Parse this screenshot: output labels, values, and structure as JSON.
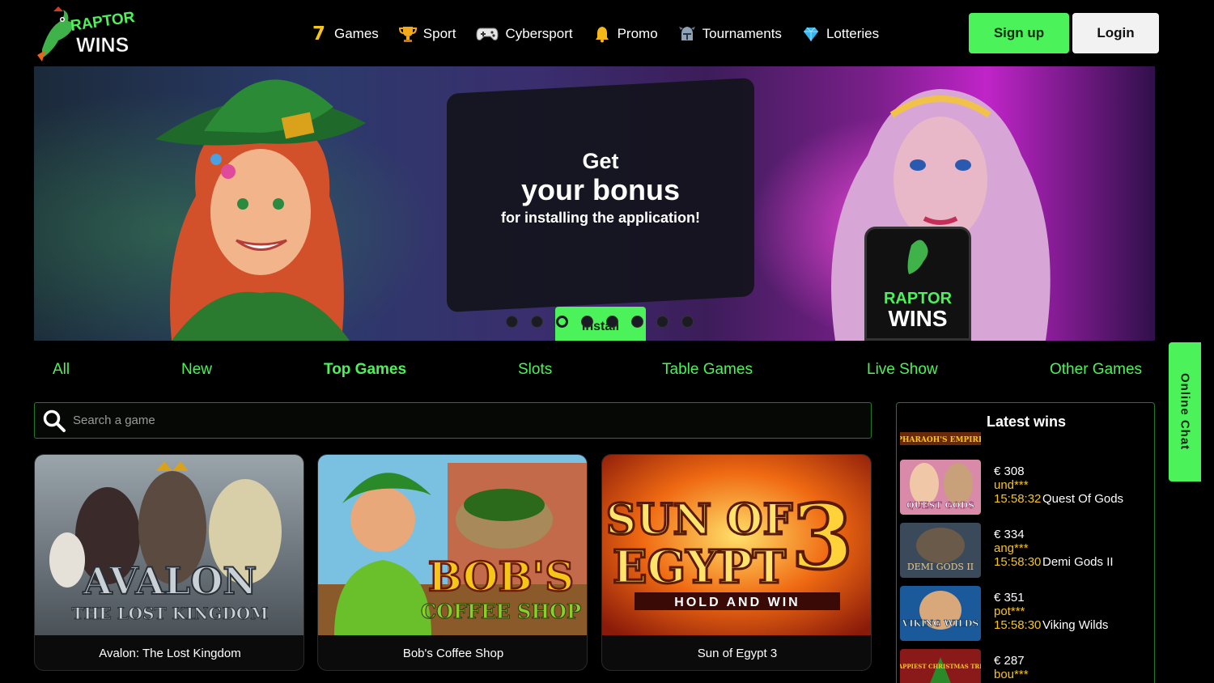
{
  "brand": {
    "logo_line1": "RAPTOR",
    "logo_line2": "WINS",
    "accent": "#4cf25a",
    "gold": "#f5c518"
  },
  "nav": {
    "items": [
      {
        "label": "Games",
        "icon": "seven-icon"
      },
      {
        "label": "Sport",
        "icon": "trophy-icon"
      },
      {
        "label": "Cybersport",
        "icon": "gamepad-icon"
      },
      {
        "label": "Promo",
        "icon": "bell-icon"
      },
      {
        "label": "Tournaments",
        "icon": "knight-helmet-icon"
      },
      {
        "label": "Lotteries",
        "icon": "diamond-icon"
      }
    ],
    "signup_label": "Sign up",
    "login_label": "Login"
  },
  "banner": {
    "line1": "Get",
    "line2": "your bonus",
    "line3": "for installing the application!",
    "install_label": "Install",
    "dots_count": 8,
    "active_dot": 3,
    "phone_logo_line1": "RAPTOR",
    "phone_logo_line2": "WINS"
  },
  "categories": [
    {
      "label": "All",
      "active": false
    },
    {
      "label": "New",
      "active": false
    },
    {
      "label": "Top Games",
      "active": true
    },
    {
      "label": "Slots",
      "active": false
    },
    {
      "label": "Table Games",
      "active": false
    },
    {
      "label": "Live Show",
      "active": false
    },
    {
      "label": "Other Games",
      "active": false
    }
  ],
  "search": {
    "placeholder": "Search a game"
  },
  "games": [
    {
      "title": "Avalon: The Lost Kingdom",
      "art_line1": "AVALON",
      "art_line2": "THE LOST KINGDOM"
    },
    {
      "title": "Bob's Coffee Shop",
      "art_line1": "BOB'S",
      "art_line2": "COFFEE SHOP"
    },
    {
      "title": "Sun of Egypt 3",
      "art_line1": "SUN OF",
      "art_line2": "EGYPT",
      "art_line3": "3",
      "art_line4": "HOLD AND WIN"
    }
  ],
  "latest_wins": {
    "title": "Latest wins",
    "partial_top_art": "PHARAOH'S EMPIRE",
    "items": [
      {
        "amount": "€ 308",
        "user": "und***",
        "time": "15:58:32",
        "game": "Quest Of Gods",
        "art": "QUEST GODS"
      },
      {
        "amount": "€ 334",
        "user": "ang***",
        "time": "15:58:30",
        "game": "Demi Gods II",
        "art": "DEMI GODS II"
      },
      {
        "amount": "€ 351",
        "user": "pot***",
        "time": "15:58:30",
        "game": "Viking Wilds",
        "art": "VIKING WILDS"
      },
      {
        "amount": "€ 287",
        "user": "bou***",
        "time": "",
        "game": "",
        "art": "HAPPIEST CHRISTMAS TREE"
      }
    ]
  },
  "online_chat": {
    "label": "Online Chat"
  }
}
